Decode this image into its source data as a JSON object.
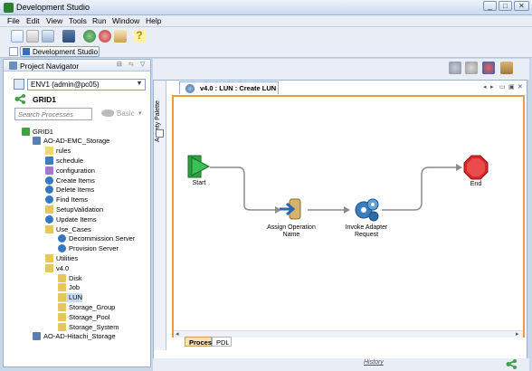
{
  "app": {
    "title": "Development Studio"
  },
  "window_buttons": [
    "_",
    "□",
    "✕"
  ],
  "menu": [
    "File",
    "Edit",
    "View",
    "Tools",
    "Run",
    "Window",
    "Help"
  ],
  "perspective_tab": "Development Studio",
  "nav": {
    "title": "Project Navigator",
    "env": "ENV1 (admin@pc05)",
    "grid_header": "GRID1",
    "search_placeholder": "Search Processes",
    "filter": "Basic"
  },
  "tree": [
    {
      "label": "GRID1",
      "icon": "grid-icon",
      "depth": 0
    },
    {
      "label": "AO-AD-EMC_Storage",
      "icon": "adapter-icon",
      "depth": 1
    },
    {
      "label": "rules",
      "icon": "rules-icon",
      "depth": 2
    },
    {
      "label": "schedule",
      "icon": "schedule-icon",
      "depth": 2
    },
    {
      "label": "configuration",
      "icon": "configuration-icon",
      "depth": 2
    },
    {
      "label": "Create Items",
      "icon": "process-icon",
      "depth": 2
    },
    {
      "label": "Delete Items",
      "icon": "process-icon",
      "depth": 2
    },
    {
      "label": "Find Items",
      "icon": "process-icon",
      "depth": 2
    },
    {
      "label": "SetupValidation",
      "icon": "folder-icon",
      "depth": 2
    },
    {
      "label": "Update Items",
      "icon": "process-icon",
      "depth": 2
    },
    {
      "label": "Use_Cases",
      "icon": "folder-icon",
      "depth": 2
    },
    {
      "label": "Decommission Server",
      "icon": "process-icon",
      "depth": 3
    },
    {
      "label": "Provision Server",
      "icon": "process-icon",
      "depth": 3
    },
    {
      "label": "Utilities",
      "icon": "folder-icon",
      "depth": 2
    },
    {
      "label": "v4.0",
      "icon": "folder-icon",
      "depth": 2
    },
    {
      "label": "Disk",
      "icon": "folder-icon",
      "depth": 3
    },
    {
      "label": "Job",
      "icon": "folder-icon",
      "depth": 3
    },
    {
      "label": "LUN",
      "icon": "folder-icon",
      "depth": 3,
      "selected": true
    },
    {
      "label": "Storage_Group",
      "icon": "folder-icon",
      "depth": 3
    },
    {
      "label": "Storage_Pool",
      "icon": "folder-icon",
      "depth": 3
    },
    {
      "label": "Storage_System",
      "icon": "folder-icon",
      "depth": 3
    },
    {
      "label": "AO-AD-Hitachi_Storage",
      "icon": "adapter-icon",
      "depth": 1
    }
  ],
  "editor": {
    "tab_title": "v4.0 : LUN : Create LUN",
    "palette_label": "Activity Palette",
    "bottom_tabs": [
      "Process",
      "PDL"
    ],
    "history": "History"
  },
  "flow": {
    "nodes": [
      {
        "id": "start",
        "label": "Start",
        "icon": "start-icon"
      },
      {
        "id": "assign",
        "label": "Assign Operation Name",
        "icon": "assign-icon"
      },
      {
        "id": "invoke",
        "label": "Invoke Adapter Request",
        "icon": "gears-icon"
      },
      {
        "id": "end",
        "label": "End",
        "icon": "stop-icon"
      }
    ]
  },
  "colors": {
    "accent": "#e89a45",
    "selection": "#c9daf2",
    "start": "#2ea043",
    "end": "#d62828"
  }
}
